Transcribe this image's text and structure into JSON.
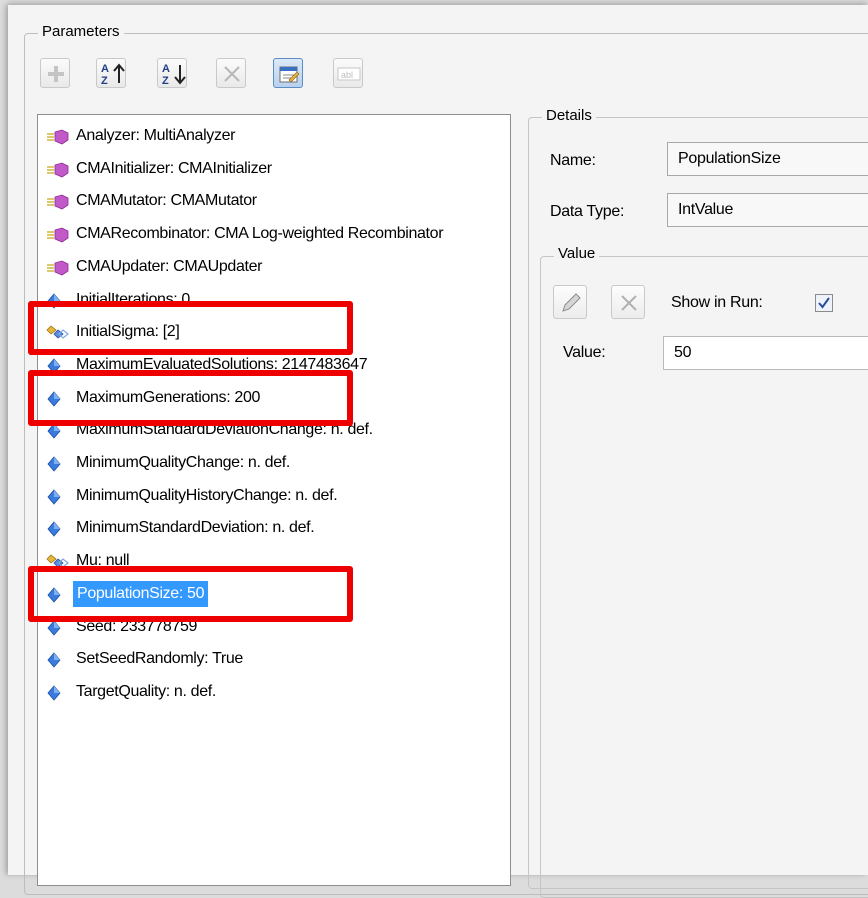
{
  "parameters_label": "Parameters",
  "toolbar": {
    "buttons": [
      {
        "name": "add-button",
        "icon": "plus-icon",
        "enabled": false
      },
      {
        "name": "sort-ascending-button",
        "icon": "sort-az-icon",
        "enabled": true
      },
      {
        "name": "sort-descending-button",
        "icon": "sort-za-icon",
        "enabled": true
      },
      {
        "name": "remove-button",
        "icon": "x-icon",
        "enabled": false
      },
      {
        "name": "properties-button",
        "icon": "properties-icon",
        "enabled": true,
        "checked": true
      },
      {
        "name": "rename-button",
        "icon": "textfield-icon",
        "enabled": false
      }
    ]
  },
  "tree": {
    "items": [
      {
        "label": "Analyzer: MultiAnalyzer",
        "icon": "operator-icon"
      },
      {
        "label": "CMAInitializer: CMAInitializer",
        "icon": "operator-icon"
      },
      {
        "label": "CMAMutator: CMAMutator",
        "icon": "operator-icon"
      },
      {
        "label": "CMARecombinator: CMA Log-weighted Recombinator",
        "icon": "operator-icon"
      },
      {
        "label": "CMAUpdater: CMAUpdater",
        "icon": "operator-icon"
      },
      {
        "label": "InitialIterations: 0",
        "icon": "value-icon"
      },
      {
        "label": "InitialSigma: [2]",
        "icon": "array-icon"
      },
      {
        "label": "MaximumEvaluatedSolutions: 2147483647",
        "icon": "value-icon"
      },
      {
        "label": "MaximumGenerations: 200",
        "icon": "value-icon"
      },
      {
        "label": "MaximumStandardDeviationChange: n. def.",
        "icon": "value-icon"
      },
      {
        "label": "MinimumQualityChange: n. def.",
        "icon": "value-icon"
      },
      {
        "label": "MinimumQualityHistoryChange: n. def.",
        "icon": "value-icon"
      },
      {
        "label": "MinimumStandardDeviation: n. def.",
        "icon": "value-icon"
      },
      {
        "label": "Mu: null",
        "icon": "array-icon"
      },
      {
        "label": "PopulationSize: 50",
        "icon": "value-icon",
        "selected": true
      },
      {
        "label": "Seed: 233778759",
        "icon": "value-icon"
      },
      {
        "label": "SetSeedRandomly: True",
        "icon": "value-icon"
      },
      {
        "label": "TargetQuality: n. def.",
        "icon": "value-icon"
      }
    ]
  },
  "details": {
    "legend": "Details",
    "name_label": "Name:",
    "name_value": "PopulationSize",
    "datatype_label": "Data Type:",
    "datatype_value": "IntValue",
    "value_group": {
      "legend": "Value",
      "edit_icon": "pencil-icon",
      "clear_icon": "x-icon",
      "show_in_run_label": "Show in Run:",
      "show_in_run_checked": true,
      "value_label": "Value:",
      "value": "50"
    }
  },
  "highlight_color": "#ee0000",
  "selection_color": "#3399ff"
}
